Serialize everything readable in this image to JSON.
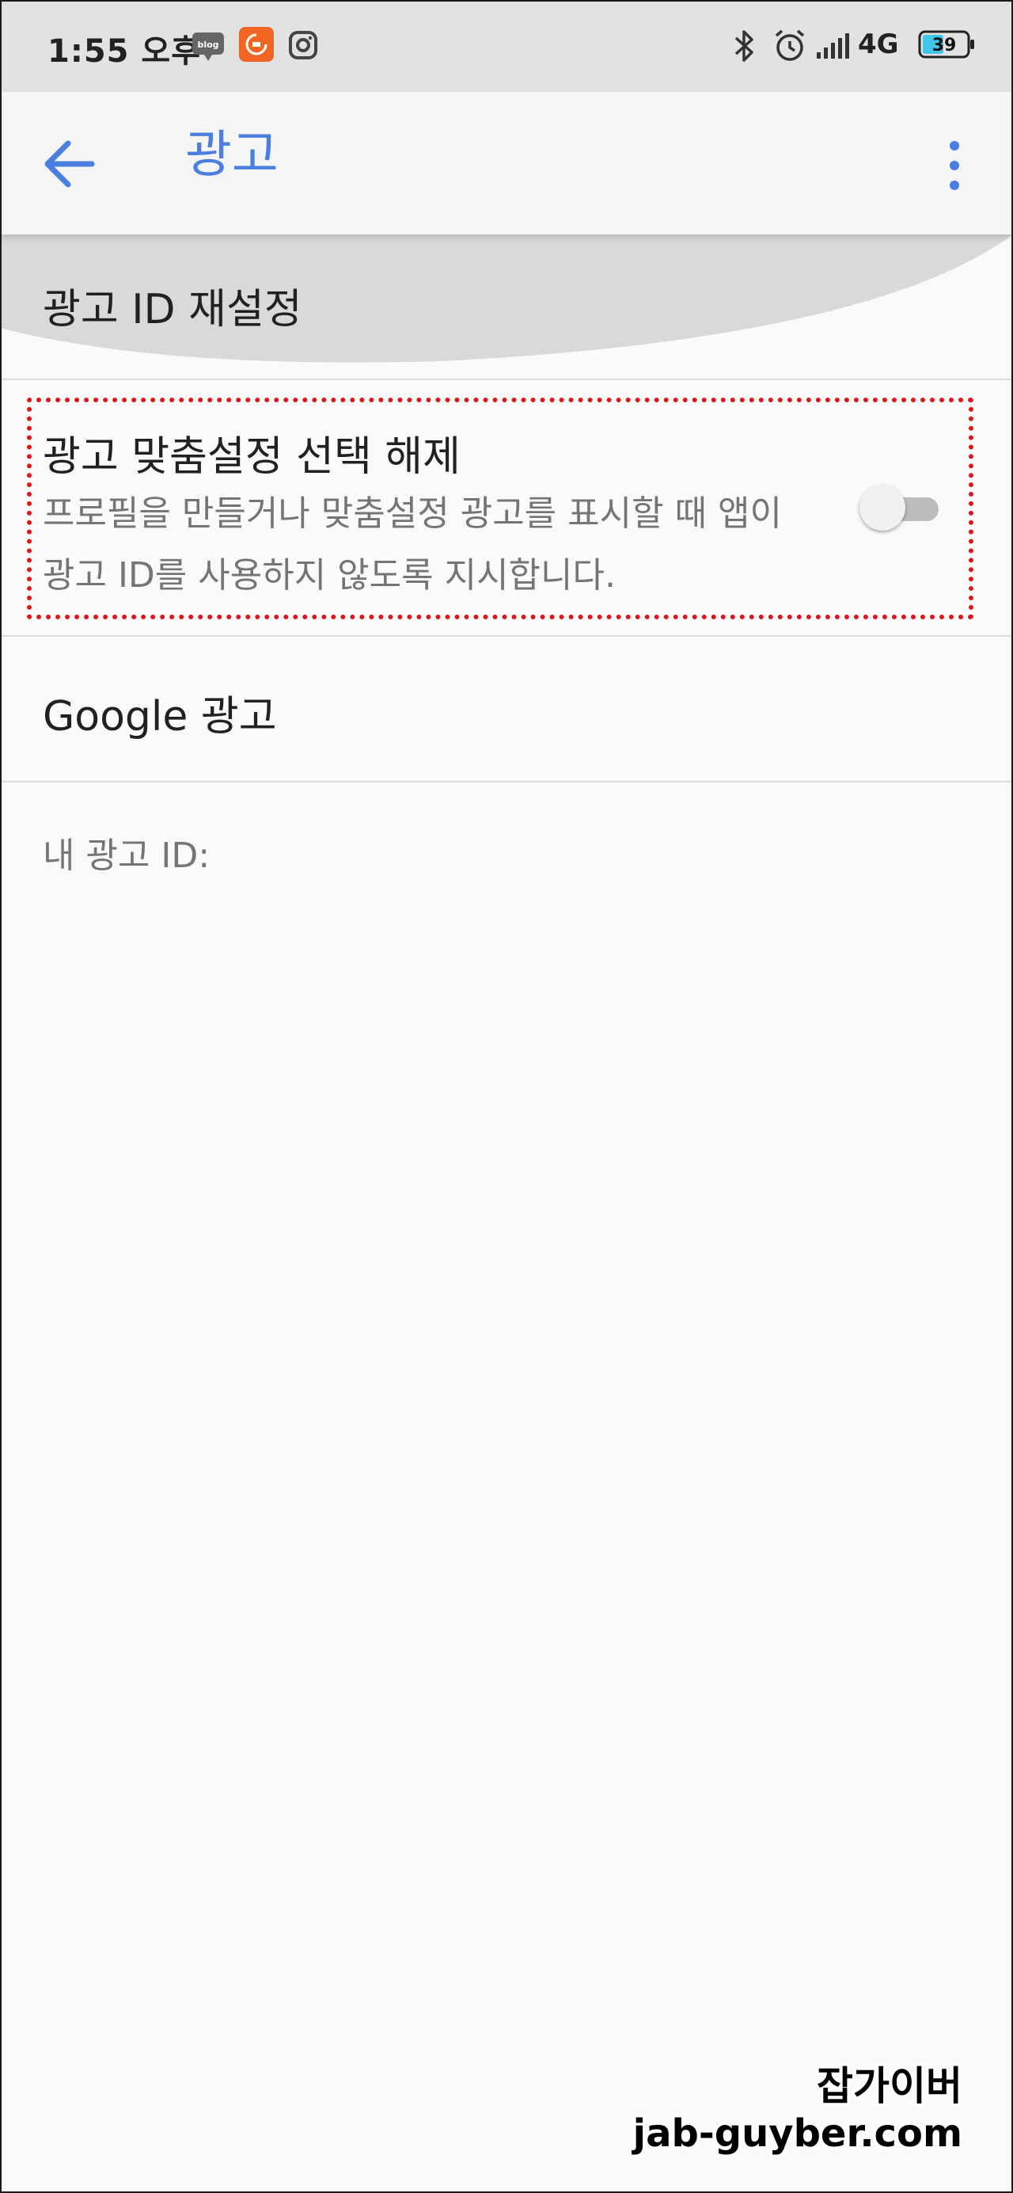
{
  "status_bar": {
    "time": "1:55 오후",
    "blog_icon_text": "blog",
    "network": "4G",
    "battery": "39"
  },
  "app_bar": {
    "title": "광고"
  },
  "settings": {
    "reset_ad_id": "광고 ID 재설정",
    "opt_out": {
      "title": "광고 맞춤설정 선택 해제",
      "description": "프로필을 만들거나 맞춤설정 광고를 표시할 때 앱이 광고 ID를 사용하지 않도록 지시합니다.",
      "enabled": false
    },
    "google_ads": "Google 광고",
    "my_ad_id_label": "내 광고 ID:"
  },
  "watermark": {
    "line1": "잡가이버",
    "line2": "jab-guyber.com"
  },
  "colors": {
    "accent": "#4a7fe0",
    "highlight": "#e0161c",
    "status_bar_bg": "#e2e2e2",
    "app_bar_bg": "#f5f5f5",
    "content_bg": "#fafafa"
  },
  "icons": {
    "back": "arrow-left-icon",
    "more": "more-vertical-icon",
    "bluetooth": "bluetooth-icon",
    "alarm": "alarm-icon",
    "signal": "signal-icon",
    "battery": "battery-icon",
    "blog": "blog-app-icon",
    "mi": "mi-app-icon",
    "instagram": "instagram-icon"
  }
}
